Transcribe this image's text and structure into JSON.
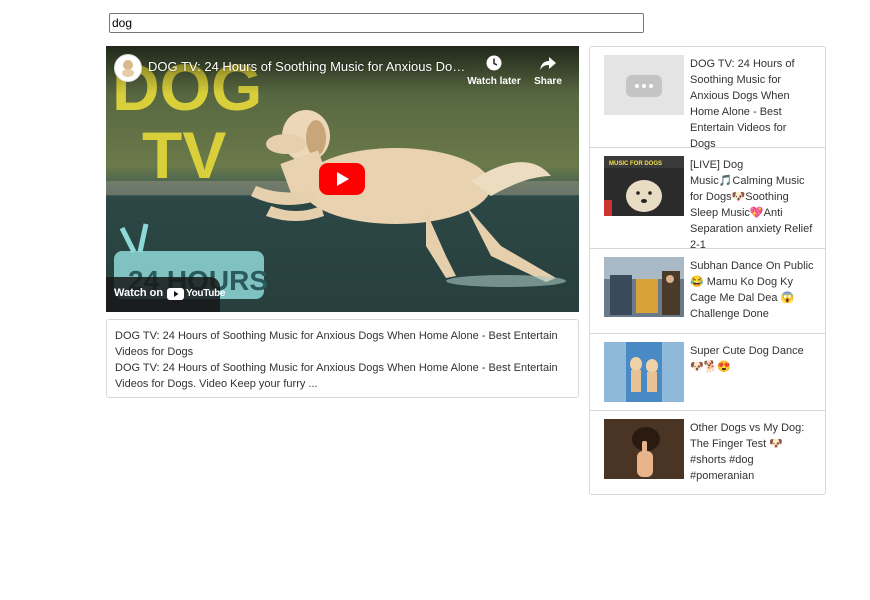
{
  "search": {
    "value": "dog"
  },
  "player": {
    "title": "DOG TV: 24 Hours of Soothing Music for Anxious Dogs When Home Alone - Best Entertain Videos for Dogs",
    "thumb_text_dog": "DOG",
    "thumb_text_tv": "TV",
    "thumb_text_24": "24 HOURS",
    "watch_later_label": "Watch later",
    "share_label": "Share",
    "watch_on_label": "Watch on",
    "youtube_label": "YouTube"
  },
  "description": {
    "title": "DOG TV: 24 Hours of Soothing Music for Anxious Dogs When Home Alone - Best Entertain Videos for Dogs",
    "snippet": "DOG TV: 24 Hours of Soothing Music for Anxious Dogs When Home Alone - Best Entertain Videos for Dogs. Video Keep your furry ..."
  },
  "related": [
    {
      "title": "DOG TV: 24 Hours of Soothing Music for Anxious Dogs When Home Alone - Best Entertain Videos for Dogs"
    },
    {
      "title": "[LIVE] Dog Music🎵Calming Music for Dogs🐶Soothing Sleep Music💖Anti Separation anxiety Relief 2-1",
      "thumb_label": "MUSIC FOR DOGS"
    },
    {
      "title": "Subhan Dance On Public 😂 Mamu Ko Dog Ky Cage Me Dal Dea 😱 Challenge Done"
    },
    {
      "title": "Super Cute Dog Dance 🐶🐕😍"
    },
    {
      "title": "Other Dogs vs My Dog: The Finger Test 🐶 #shorts #dog #pomeranian"
    }
  ],
  "colors": {
    "play_red": "#ff0000",
    "border": "#d9d9d9",
    "text": "#333333"
  }
}
